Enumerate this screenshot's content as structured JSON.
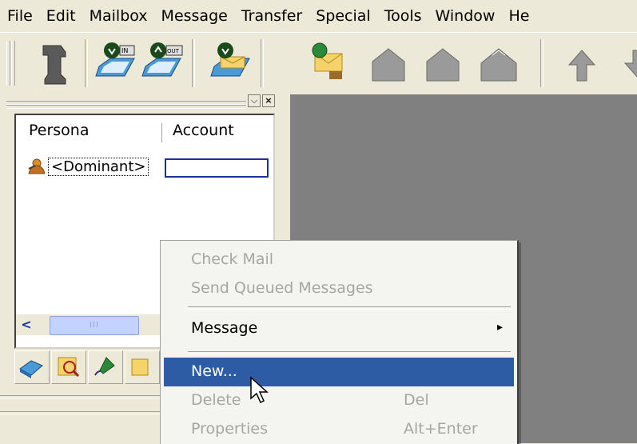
{
  "menubar": [
    "File",
    "Edit",
    "Mailbox",
    "Message",
    "Transfer",
    "Special",
    "Tools",
    "Window",
    "He"
  ],
  "toolbar": {
    "buttons": [
      "tower-icon",
      "inbox-icon",
      "outbox-icon",
      "mail-tray-icon",
      "check-mail-icon",
      "house-icon",
      "house-icon",
      "house-icon",
      "up-arrow-icon"
    ]
  },
  "pane": {
    "dropdown_label": "⌵",
    "close_label": "×",
    "columns": [
      "Persona",
      "Account"
    ],
    "rows": [
      {
        "persona": "<Dominant>",
        "account": ""
      }
    ],
    "scroll_left": "<",
    "scroll_thumb": "III"
  },
  "context_menu": {
    "items": [
      {
        "label": "Check Mail",
        "shortcut": "",
        "disabled": true
      },
      {
        "label": "Send Queued Messages",
        "shortcut": "",
        "disabled": true
      },
      {
        "label": "Message",
        "shortcut": "",
        "disabled": false,
        "submenu": "▸"
      },
      {
        "label": "New...",
        "shortcut": "",
        "disabled": false,
        "highlighted": true
      },
      {
        "label": "Delete",
        "shortcut": "Del",
        "disabled": true
      },
      {
        "label": "Properties",
        "shortcut": "Alt+Enter",
        "disabled": true
      }
    ]
  },
  "colors": {
    "highlight": "#2d5ba4",
    "workspace": "#808080",
    "chrome": "#ece9d8"
  }
}
